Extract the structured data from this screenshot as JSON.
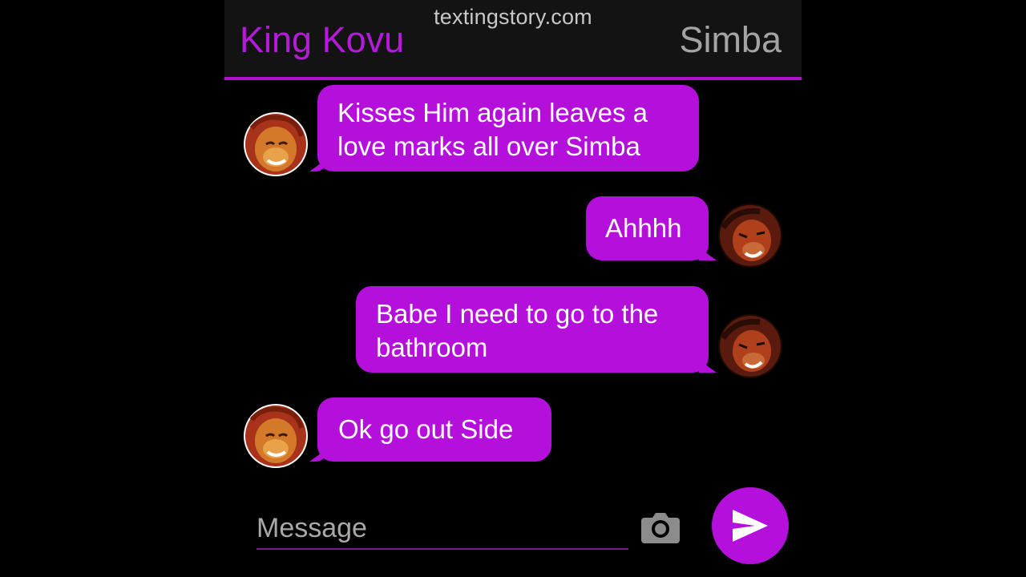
{
  "header": {
    "watermark": "textingstory.com",
    "contact_left": "King Kovu",
    "contact_right": "Simba"
  },
  "messages": [
    {
      "side": "left",
      "lines": [
        "Kisses Him again leaves a",
        "love marks all over Simba"
      ],
      "avatar": "simba-avatar"
    },
    {
      "side": "right",
      "lines": [
        "Ahhhh"
      ],
      "avatar": "kovu-avatar"
    },
    {
      "side": "right",
      "lines": [
        "Babe I need to go to the",
        "bathroom"
      ],
      "avatar": "kovu-avatar"
    },
    {
      "side": "left",
      "lines": [
        "Ok go out Side"
      ],
      "avatar": "simba-avatar"
    }
  ],
  "composer": {
    "placeholder": "Message",
    "camera_icon": "camera-icon",
    "send_icon": "send-icon"
  },
  "colors": {
    "accent": "#b40fdb",
    "header_bg": "#131313",
    "background": "#000000",
    "contact_left": "#b41bd9",
    "contact_right": "#a4a4a4"
  }
}
